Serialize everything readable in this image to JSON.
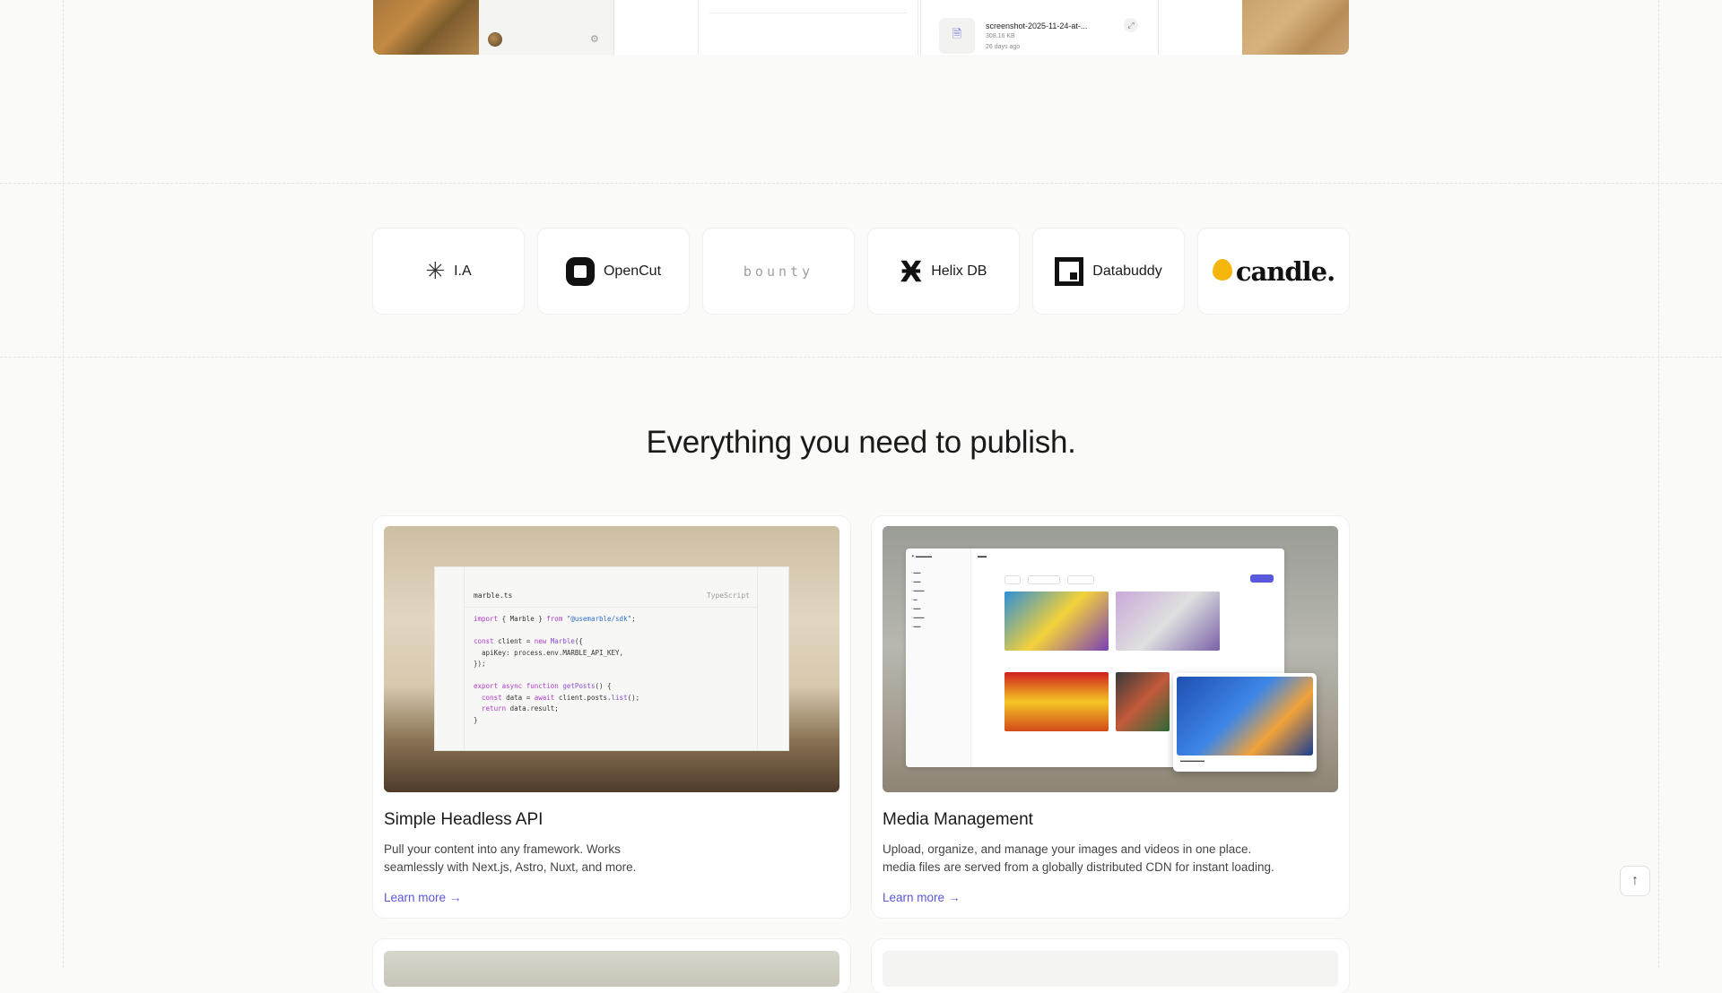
{
  "top_strip": {
    "file": {
      "name": "screenshot-2025-11-24-at-...",
      "size": "308.16 KB",
      "age": "26 days ago"
    }
  },
  "logos": [
    {
      "name": "I.A",
      "icon": "asterisk-icon"
    },
    {
      "name": "OpenCut",
      "icon": "opencut-logo-icon"
    },
    {
      "name": "bounty",
      "icon": "bounty-wordmark"
    },
    {
      "name": "Helix DB",
      "icon": "helix-logo-icon"
    },
    {
      "name": "Databuddy",
      "icon": "databuddy-logo-icon"
    },
    {
      "name": "candle.",
      "icon": "candle-flame-icon"
    }
  ],
  "section": {
    "title": "Everything you need to publish."
  },
  "features": [
    {
      "title": "Simple Headless API",
      "desc_lines": [
        "Pull your content into any framework. Works",
        "seamlessly with Next.js, Astro, Nuxt, and more."
      ],
      "link": "Learn more",
      "code": {
        "filename": "marble.ts",
        "language": "TypeScript"
      }
    },
    {
      "title": "Media Management",
      "desc_lines": [
        "Upload, organize, and manage your images and videos in one place.",
        "media files are served from a globally distributed CDN for instant loading."
      ],
      "link": "Learn more"
    }
  ],
  "colors": {
    "accent": "#5a56d6",
    "background": "#fafaf8",
    "card": "#ffffff",
    "candle": "#f5b60c"
  },
  "icons": {
    "link_arrow": "arrow-right-icon",
    "scroll_top": "arrow-up-icon"
  }
}
